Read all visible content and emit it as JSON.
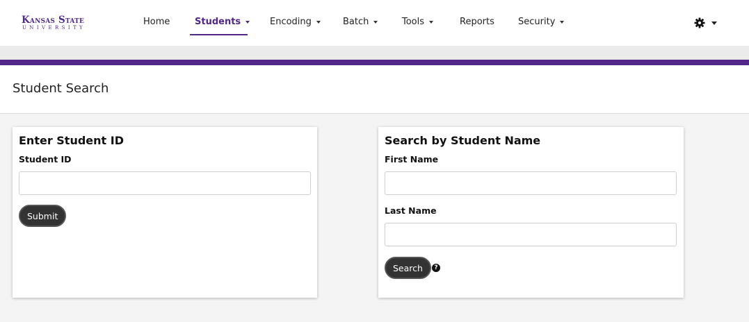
{
  "brand": {
    "line1": "Kansas State",
    "line2": "UNIVERSITY"
  },
  "nav": {
    "items": [
      {
        "label": "Home",
        "dropdown": false
      },
      {
        "label": "Students",
        "dropdown": true,
        "active": true
      },
      {
        "label": "Encoding",
        "dropdown": true
      },
      {
        "label": "Batch",
        "dropdown": true
      },
      {
        "label": "Tools",
        "dropdown": true
      },
      {
        "label": "Reports",
        "dropdown": false
      },
      {
        "label": "Security",
        "dropdown": true
      }
    ],
    "settings_icon": "gear-icon"
  },
  "colors": {
    "accent": "#512888",
    "button": "#333333"
  },
  "page": {
    "title": "Student Search"
  },
  "id_search": {
    "title": "Enter Student ID",
    "field_label": "Student ID",
    "value": "",
    "submit_label": "Submit"
  },
  "name_search": {
    "title": "Search by Student Name",
    "first_label": "First Name",
    "first_value": "",
    "last_label": "Last Name",
    "last_value": "",
    "search_label": "Search",
    "help_icon": "question-circle-icon"
  }
}
